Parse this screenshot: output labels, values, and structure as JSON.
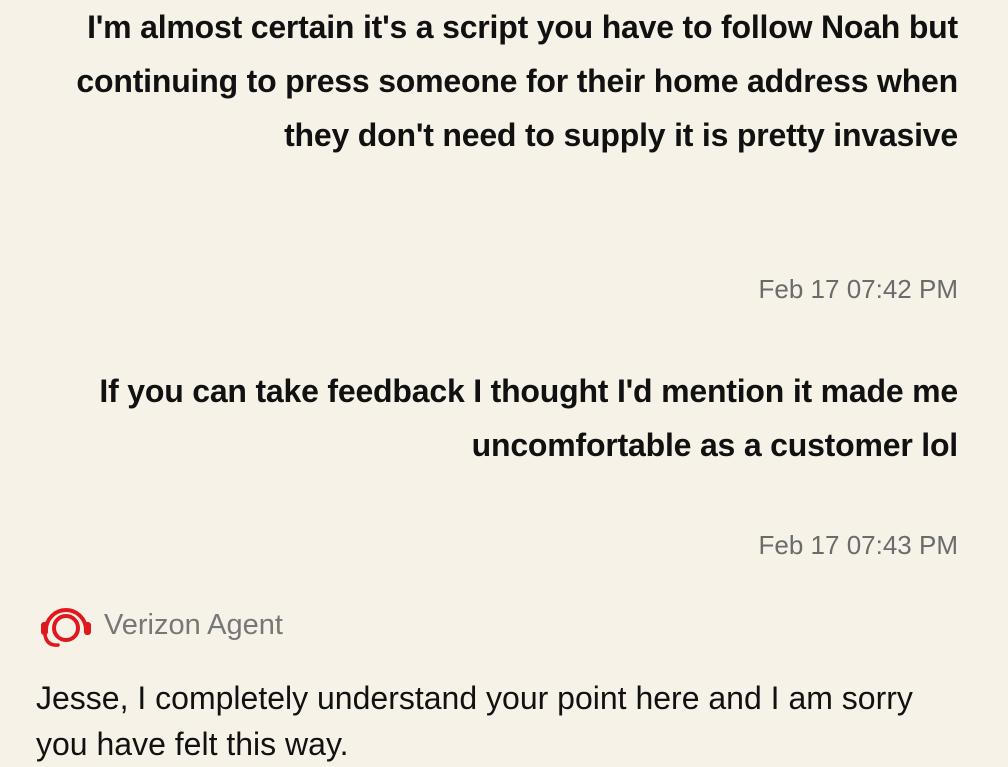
{
  "conversation": {
    "messages": [
      {
        "sender": "customer",
        "text": "I'm almost certain it's a script you have to follow Noah but continuing to press someone for their home address when they don't need to supply it is pretty invasive",
        "timestamp": "Feb 17 07:42 PM"
      },
      {
        "sender": "customer",
        "text": "If you can take feedback I thought I'd mention it made me uncomfortable as a customer lol",
        "timestamp": "Feb 17 07:43 PM"
      }
    ],
    "agent": {
      "name": "Verizon Agent",
      "icon": "headset-icon",
      "message": "Jesse, I completely understand your point here and I am sorry you have felt this way."
    }
  },
  "colors": {
    "background": "#f6f2e8",
    "text": "#111111",
    "timestamp": "#6b6b6b",
    "agent_name": "#777777",
    "brand_red": "#e0181e"
  }
}
